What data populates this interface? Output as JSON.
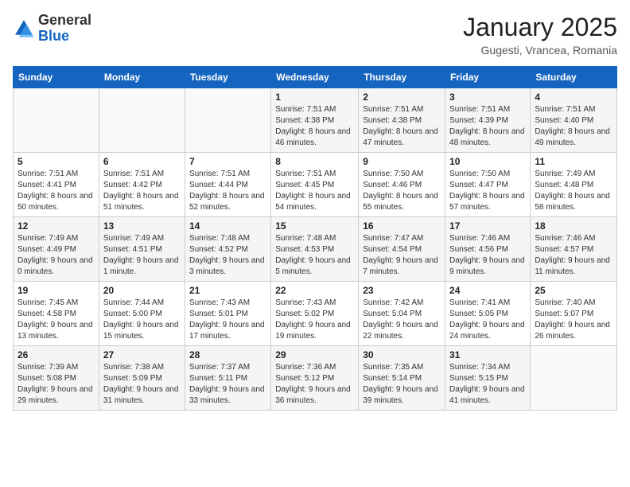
{
  "logo": {
    "general": "General",
    "blue": "Blue"
  },
  "title": "January 2025",
  "subtitle": "Gugesti, Vrancea, Romania",
  "days_header": [
    "Sunday",
    "Monday",
    "Tuesday",
    "Wednesday",
    "Thursday",
    "Friday",
    "Saturday"
  ],
  "weeks": [
    [
      {
        "num": "",
        "info": ""
      },
      {
        "num": "",
        "info": ""
      },
      {
        "num": "",
        "info": ""
      },
      {
        "num": "1",
        "info": "Sunrise: 7:51 AM\nSunset: 4:38 PM\nDaylight: 8 hours and 46 minutes."
      },
      {
        "num": "2",
        "info": "Sunrise: 7:51 AM\nSunset: 4:38 PM\nDaylight: 8 hours and 47 minutes."
      },
      {
        "num": "3",
        "info": "Sunrise: 7:51 AM\nSunset: 4:39 PM\nDaylight: 8 hours and 48 minutes."
      },
      {
        "num": "4",
        "info": "Sunrise: 7:51 AM\nSunset: 4:40 PM\nDaylight: 8 hours and 49 minutes."
      }
    ],
    [
      {
        "num": "5",
        "info": "Sunrise: 7:51 AM\nSunset: 4:41 PM\nDaylight: 8 hours and 50 minutes."
      },
      {
        "num": "6",
        "info": "Sunrise: 7:51 AM\nSunset: 4:42 PM\nDaylight: 8 hours and 51 minutes."
      },
      {
        "num": "7",
        "info": "Sunrise: 7:51 AM\nSunset: 4:44 PM\nDaylight: 8 hours and 52 minutes."
      },
      {
        "num": "8",
        "info": "Sunrise: 7:51 AM\nSunset: 4:45 PM\nDaylight: 8 hours and 54 minutes."
      },
      {
        "num": "9",
        "info": "Sunrise: 7:50 AM\nSunset: 4:46 PM\nDaylight: 8 hours and 55 minutes."
      },
      {
        "num": "10",
        "info": "Sunrise: 7:50 AM\nSunset: 4:47 PM\nDaylight: 8 hours and 57 minutes."
      },
      {
        "num": "11",
        "info": "Sunrise: 7:49 AM\nSunset: 4:48 PM\nDaylight: 8 hours and 58 minutes."
      }
    ],
    [
      {
        "num": "12",
        "info": "Sunrise: 7:49 AM\nSunset: 4:49 PM\nDaylight: 9 hours and 0 minutes."
      },
      {
        "num": "13",
        "info": "Sunrise: 7:49 AM\nSunset: 4:51 PM\nDaylight: 9 hours and 1 minute."
      },
      {
        "num": "14",
        "info": "Sunrise: 7:48 AM\nSunset: 4:52 PM\nDaylight: 9 hours and 3 minutes."
      },
      {
        "num": "15",
        "info": "Sunrise: 7:48 AM\nSunset: 4:53 PM\nDaylight: 9 hours and 5 minutes."
      },
      {
        "num": "16",
        "info": "Sunrise: 7:47 AM\nSunset: 4:54 PM\nDaylight: 9 hours and 7 minutes."
      },
      {
        "num": "17",
        "info": "Sunrise: 7:46 AM\nSunset: 4:56 PM\nDaylight: 9 hours and 9 minutes."
      },
      {
        "num": "18",
        "info": "Sunrise: 7:46 AM\nSunset: 4:57 PM\nDaylight: 9 hours and 11 minutes."
      }
    ],
    [
      {
        "num": "19",
        "info": "Sunrise: 7:45 AM\nSunset: 4:58 PM\nDaylight: 9 hours and 13 minutes."
      },
      {
        "num": "20",
        "info": "Sunrise: 7:44 AM\nSunset: 5:00 PM\nDaylight: 9 hours and 15 minutes."
      },
      {
        "num": "21",
        "info": "Sunrise: 7:43 AM\nSunset: 5:01 PM\nDaylight: 9 hours and 17 minutes."
      },
      {
        "num": "22",
        "info": "Sunrise: 7:43 AM\nSunset: 5:02 PM\nDaylight: 9 hours and 19 minutes."
      },
      {
        "num": "23",
        "info": "Sunrise: 7:42 AM\nSunset: 5:04 PM\nDaylight: 9 hours and 22 minutes."
      },
      {
        "num": "24",
        "info": "Sunrise: 7:41 AM\nSunset: 5:05 PM\nDaylight: 9 hours and 24 minutes."
      },
      {
        "num": "25",
        "info": "Sunrise: 7:40 AM\nSunset: 5:07 PM\nDaylight: 9 hours and 26 minutes."
      }
    ],
    [
      {
        "num": "26",
        "info": "Sunrise: 7:39 AM\nSunset: 5:08 PM\nDaylight: 9 hours and 29 minutes."
      },
      {
        "num": "27",
        "info": "Sunrise: 7:38 AM\nSunset: 5:09 PM\nDaylight: 9 hours and 31 minutes."
      },
      {
        "num": "28",
        "info": "Sunrise: 7:37 AM\nSunset: 5:11 PM\nDaylight: 9 hours and 33 minutes."
      },
      {
        "num": "29",
        "info": "Sunrise: 7:36 AM\nSunset: 5:12 PM\nDaylight: 9 hours and 36 minutes."
      },
      {
        "num": "30",
        "info": "Sunrise: 7:35 AM\nSunset: 5:14 PM\nDaylight: 9 hours and 39 minutes."
      },
      {
        "num": "31",
        "info": "Sunrise: 7:34 AM\nSunset: 5:15 PM\nDaylight: 9 hours and 41 minutes."
      },
      {
        "num": "",
        "info": ""
      }
    ]
  ]
}
